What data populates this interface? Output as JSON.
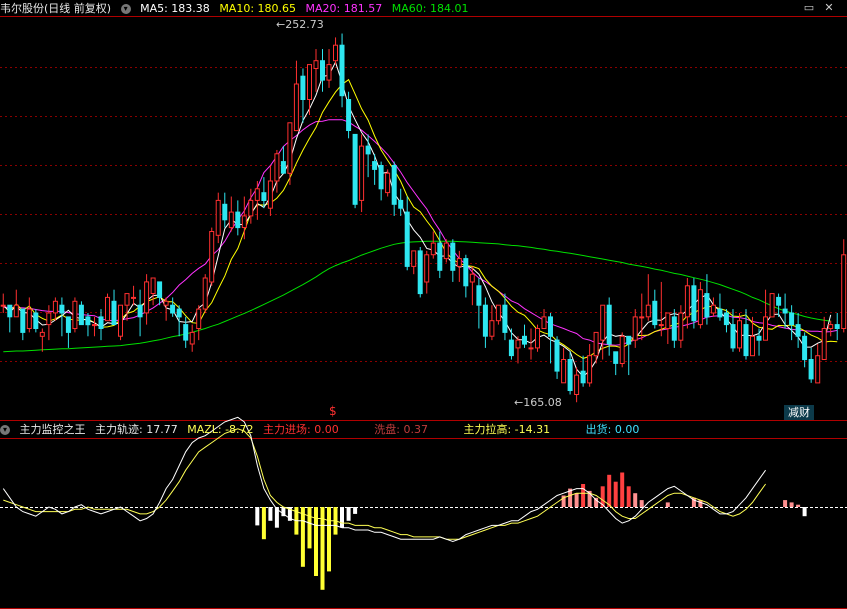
{
  "title": "韦尔股份(日线 前复权)",
  "ma": {
    "ma5": "MA5: 183.38",
    "ma10": "MA10: 180.65",
    "ma20": "MA20: 181.57",
    "ma60": "MA60: 184.01"
  },
  "colors": {
    "up": "#ff3030",
    "down": "#2ee6f0",
    "ma5": "#ffffff",
    "ma10": "#ffff00",
    "ma20": "#ff33ff",
    "ma60": "#00e000",
    "grid": "#8b0000"
  },
  "price_labels": {
    "high": "252.73",
    "low": "165.08"
  },
  "signal_marker": "$",
  "tag": "减财",
  "close_symbol": "✕",
  "indicator": {
    "name": "主力监控之王",
    "guiji": "主力轨迹: 17.77",
    "mazl": "MAZL: -8.72",
    "jinchang": "主力进场: 0.00",
    "xipan": "洗盘: 0.37",
    "lagao": "主力拉高: -14.31",
    "chuhuo": "出货: 0.00"
  },
  "chart_data": {
    "type": "candlestick",
    "candles": [
      [
        183,
        183,
        181,
        186
      ],
      [
        183,
        180,
        176,
        183
      ],
      [
        180,
        183,
        180,
        187
      ],
      [
        182,
        176,
        174,
        182
      ],
      [
        177,
        182,
        176,
        185
      ],
      [
        181,
        177,
        176,
        182
      ],
      [
        175,
        176,
        171,
        177
      ],
      [
        178,
        181,
        174,
        183
      ],
      [
        181,
        184,
        179,
        185
      ],
      [
        183,
        181,
        175,
        185
      ],
      [
        180,
        176,
        172,
        180
      ],
      [
        177,
        184,
        176,
        185
      ],
      [
        183,
        178,
        178,
        184
      ],
      [
        180,
        178,
        175,
        181
      ],
      [
        178,
        178,
        175,
        180
      ],
      [
        180,
        177,
        174,
        182
      ],
      [
        179,
        185,
        179,
        186
      ],
      [
        184,
        178,
        178,
        187
      ],
      [
        175,
        183,
        174,
        183
      ],
      [
        183,
        186,
        179,
        186
      ],
      [
        185,
        185,
        183,
        188
      ],
      [
        183,
        180,
        175,
        187
      ],
      [
        181,
        189,
        178,
        191
      ],
      [
        186,
        190,
        183,
        190
      ],
      [
        189,
        185,
        183,
        189
      ],
      [
        183,
        184,
        179,
        185
      ],
      [
        183,
        181,
        180,
        185
      ],
      [
        182,
        180,
        175,
        183
      ],
      [
        178,
        174,
        172,
        180
      ],
      [
        173,
        176,
        171,
        178
      ],
      [
        177,
        182,
        174,
        183
      ],
      [
        182,
        190,
        181,
        191
      ],
      [
        189,
        202,
        188,
        203
      ],
      [
        201,
        210,
        199,
        212
      ],
      [
        209,
        205,
        203,
        212
      ],
      [
        203,
        207,
        202,
        211
      ],
      [
        207,
        203,
        201,
        210
      ],
      [
        203,
        206,
        200,
        211
      ],
      [
        206,
        210,
        204,
        213
      ],
      [
        210,
        213,
        205,
        215
      ],
      [
        212,
        210,
        208,
        216
      ],
      [
        208,
        215,
        206,
        219
      ],
      [
        215,
        222,
        212,
        223
      ],
      [
        220,
        217,
        217,
        224
      ],
      [
        217,
        230,
        214,
        230
      ],
      [
        228,
        240,
        228,
        246
      ],
      [
        242,
        236,
        230,
        244
      ],
      [
        236,
        245,
        232,
        245
      ],
      [
        244,
        246,
        238,
        249
      ],
      [
        246,
        241,
        238,
        249
      ],
      [
        241,
        245,
        239,
        249
      ],
      [
        246,
        250,
        245,
        252
      ],
      [
        250,
        237,
        234,
        253
      ],
      [
        236,
        228,
        226,
        238
      ],
      [
        227,
        209,
        208,
        227
      ],
      [
        210,
        224,
        207,
        227
      ],
      [
        224,
        222,
        216,
        227
      ],
      [
        220,
        218,
        214,
        222
      ],
      [
        219,
        213,
        210,
        220
      ],
      [
        212,
        217,
        211,
        218
      ],
      [
        219,
        209,
        206,
        220
      ],
      [
        210,
        208,
        206,
        213
      ],
      [
        207,
        193,
        192,
        211
      ],
      [
        193,
        197,
        191,
        197
      ],
      [
        197,
        186,
        185,
        198
      ],
      [
        189,
        196,
        186,
        197
      ],
      [
        196,
        199,
        195,
        202
      ],
      [
        199,
        192,
        190,
        202
      ],
      [
        195,
        199,
        194,
        200
      ],
      [
        199,
        192,
        189,
        200
      ],
      [
        193,
        195,
        189,
        197
      ],
      [
        195,
        188,
        185,
        196
      ],
      [
        189,
        191,
        183,
        193
      ],
      [
        188,
        183,
        177,
        190
      ],
      [
        183,
        175,
        172,
        185
      ],
      [
        175,
        179,
        174,
        183
      ],
      [
        179,
        183,
        178,
        183
      ],
      [
        183,
        176,
        174,
        186
      ],
      [
        174,
        170,
        169,
        177
      ],
      [
        172,
        174,
        168,
        175
      ],
      [
        175,
        173,
        172,
        178
      ],
      [
        172,
        172,
        169,
        177
      ],
      [
        172,
        177,
        171,
        178
      ],
      [
        177,
        180,
        177,
        182
      ],
      [
        180,
        175,
        168,
        181
      ],
      [
        174,
        166,
        164,
        175
      ],
      [
        163,
        169,
        163,
        172
      ],
      [
        169,
        161,
        160,
        171
      ],
      [
        160,
        165,
        158,
        167
      ],
      [
        166,
        163,
        162,
        170
      ],
      [
        163,
        170,
        162,
        173
      ],
      [
        170,
        176,
        168,
        176
      ],
      [
        174,
        183,
        169,
        183
      ],
      [
        183,
        173,
        170,
        185
      ],
      [
        171,
        168,
        165,
        171
      ],
      [
        168,
        175,
        167,
        176
      ],
      [
        175,
        173,
        165,
        175
      ],
      [
        174,
        180,
        172,
        182
      ],
      [
        180,
        180,
        174,
        186
      ],
      [
        180,
        183,
        179,
        191
      ],
      [
        184,
        178,
        177,
        187
      ],
      [
        178,
        178,
        175,
        189
      ],
      [
        177,
        181,
        173,
        181
      ],
      [
        180,
        174,
        172,
        182
      ],
      [
        174,
        181,
        172,
        183
      ],
      [
        180,
        188,
        177,
        190
      ],
      [
        188,
        179,
        177,
        190
      ],
      [
        178,
        187,
        177,
        189
      ],
      [
        186,
        180,
        178,
        191
      ],
      [
        181,
        183,
        180,
        185
      ],
      [
        182,
        180,
        179,
        186
      ],
      [
        181,
        178,
        176,
        182
      ],
      [
        178,
        172,
        171,
        182
      ],
      [
        172,
        179,
        171,
        181
      ],
      [
        178,
        170,
        169,
        182
      ],
      [
        170,
        175,
        170,
        180
      ],
      [
        175,
        174,
        170,
        177
      ],
      [
        174,
        180,
        174,
        187
      ],
      [
        180,
        186,
        180,
        186
      ],
      [
        185,
        183,
        180,
        186
      ],
      [
        182,
        181,
        177,
        186
      ],
      [
        181,
        178,
        174,
        183
      ],
      [
        178,
        175,
        172,
        181
      ],
      [
        175,
        169,
        167,
        176
      ],
      [
        169,
        164,
        163,
        172
      ],
      [
        163,
        170,
        163,
        173
      ],
      [
        169,
        177,
        169,
        180
      ],
      [
        177,
        178,
        175,
        179
      ],
      [
        178,
        177,
        174,
        181
      ],
      [
        177,
        196,
        176,
        200
      ]
    ],
    "ma5": [
      183,
      181.3,
      182.7,
      181.1,
      181,
      179.3,
      177.9,
      178.1,
      179.2,
      180.3,
      181.7,
      180,
      179.5,
      179.1,
      178.5,
      177.3,
      178.5,
      178.2,
      178.4,
      180.8,
      183.5,
      182.3,
      184.1,
      185.5,
      185.6,
      182.3,
      181.8,
      178.8,
      178.6,
      178.8,
      182.3,
      183.6,
      188.9,
      195.8,
      202.7,
      205,
      203.9,
      203.7,
      206.4,
      209.2,
      208.2,
      210.9,
      215,
      216.9,
      220.2,
      225.9,
      230.6,
      233.6,
      237.1,
      241.9,
      242.3,
      245.6,
      240.3,
      234.3,
      230.8,
      227.5,
      225.1,
      221.5,
      216.9,
      217.3,
      211.8,
      209.4,
      205,
      202.4,
      200.5,
      197.6,
      197.2,
      195.6,
      195.7,
      193.8,
      192.8,
      193.2,
      192.5,
      191,
      187.8,
      183.9,
      181.1,
      178.9,
      175.9,
      174.2,
      174,
      173.2,
      174.7,
      175.3,
      174.1,
      173.4,
      172.4,
      171.1,
      166.5,
      164.6,
      166.1,
      168.8,
      173.6,
      175.6,
      175,
      175.3,
      174.6,
      174.5,
      176.6,
      178.6,
      179.2,
      179.1,
      180.4,
      180.8,
      180.4,
      181.7,
      183.3,
      184.9,
      185.7,
      183.1,
      181.4,
      179.4,
      177.4,
      175.2,
      175.3,
      175.1,
      175.7,
      178.4,
      180.6,
      180.7,
      178,
      176.5,
      174.8,
      172.2,
      172.2,
      173.2,
      173.9,
      180.5
    ],
    "ma10": [
      183,
      181.2,
      183.3,
      181.6,
      182.8,
      180.6,
      179.6,
      178.9,
      179.5,
      180.5,
      179.5,
      179.1,
      179.2,
      179.4,
      178.5,
      177.3,
      177.4,
      177.8,
      179.3,
      180.9,
      181.4,
      182.8,
      183.9,
      184.6,
      185.2,
      183.9,
      183.9,
      182.3,
      180.3,
      178.5,
      178.3,
      181.5,
      183.7,
      187.2,
      190.5,
      194.8,
      197.6,
      202.1,
      206.7,
      208.9,
      208.8,
      209.3,
      210.6,
      212.6,
      215.8,
      219.6,
      223,
      226,
      228.8,
      232.7,
      235.4,
      237.9,
      239.9,
      241.1,
      237.4,
      233.6,
      230.7,
      226.6,
      223,
      220.3,
      217.8,
      214.9,
      211.1,
      208.3,
      207.1,
      204.7,
      202.5,
      199.6,
      196.5,
      194.8,
      193.8,
      193.2,
      193,
      192.4,
      189.8,
      187.9,
      186.6,
      184.8,
      182.7,
      181.2,
      180.4,
      178.6,
      176.6,
      175.9,
      175.4,
      173.8,
      172.8,
      171.6,
      170.3,
      169.3,
      169.8,
      171.1,
      171.9,
      172.5,
      172.4,
      172,
      173,
      175.2,
      175.2,
      175.3,
      176.2,
      176.8,
      177.4,
      178,
      178.5,
      180.3,
      181.1,
      181.9,
      182.6,
      182.7,
      182.1,
      181.6,
      180.2,
      180.1,
      180.5,
      178.4,
      177.3,
      177,
      176.8,
      177.8,
      177.7,
      177.9,
      177.3,
      176.4,
      175.3,
      174.6,
      173.5,
      173.7,
      173.6
    ],
    "ma20": [
      182.5,
      182.4,
      182.4,
      182.3,
      182.2,
      181.9,
      181.6,
      181.4,
      181.4,
      181.4,
      181.1,
      180.8,
      180.6,
      180.4,
      180.3,
      179.5,
      179.1,
      179,
      179.2,
      179.5,
      179.8,
      180.5,
      181.4,
      182.3,
      183.5,
      184.7,
      186.3,
      188.2,
      189.6,
      191.2,
      192.5,
      193.6,
      195.8,
      197.3,
      199.5,
      202.4,
      205,
      207.3,
      210.7,
      213.3,
      217.2,
      219,
      221.4,
      223.9,
      225.4,
      226.7,
      228.2,
      229.4,
      230.3,
      230.4,
      230.8,
      230.8,
      230.8,
      230.2,
      229.1,
      228.1,
      226.7,
      225.2,
      223.6,
      221.8,
      219.6,
      217.3,
      214.6,
      212.3,
      210,
      207.8,
      204.8,
      202.3,
      199.4,
      197.2,
      195,
      193.5,
      191.5,
      190,
      189.1,
      187.9,
      186.6,
      185.4,
      184.1,
      183.4,
      182.1,
      181.1,
      180.1,
      179.1,
      178.2,
      177.6,
      177,
      176.3,
      175.7,
      174.4,
      174,
      173.3,
      173,
      172.8,
      172.7,
      172.9,
      173.5,
      174.1,
      174.6,
      175.4,
      176.2,
      176.6,
      176.9,
      177.3,
      177.6,
      178,
      178.5,
      179.2,
      179.9,
      180.2,
      180.3,
      180.4,
      179.9,
      179.8,
      179.5,
      178.8,
      178.5,
      178.3,
      177.8,
      177.5,
      177.1,
      176.8,
      176.6,
      176.4,
      176.3,
      176.3,
      176.1,
      176.2,
      176.5
    ],
    "ma60": [
      171,
      171.1,
      171.2,
      171.2,
      171.3,
      171.4,
      171.5,
      171.6,
      171.7,
      171.8,
      171.8,
      171.9,
      172,
      172.1,
      172.2,
      172.3,
      172.4,
      172.5,
      172.6,
      172.8,
      173,
      173.2,
      173.5,
      173.8,
      174.1,
      174.5,
      174.9,
      175.2,
      175.6,
      176,
      176.5,
      177,
      177.6,
      178.1,
      178.8,
      179.5,
      180.2,
      180.9,
      181.6,
      182.4,
      183.2,
      184,
      184.8,
      185.6,
      186.5,
      187.4,
      188.3,
      189.3,
      190.3,
      191.4,
      192.4,
      193.2,
      193.9,
      194.5,
      195.2,
      195.9,
      196.5,
      197.1,
      197.7,
      198.2,
      198.7,
      199,
      199.2,
      199.3,
      199.4,
      199.5,
      199.5,
      199.5,
      199.5,
      199.5,
      199.4,
      199.3,
      199.2,
      199.1,
      199,
      198.9,
      198.8,
      198.6,
      198.4,
      198.3,
      198.1,
      197.9,
      197.6,
      197.4,
      197.1,
      196.9,
      196.6,
      196.4,
      196.1,
      195.8,
      195.5,
      195.2,
      194.9,
      194.6,
      194.3,
      194,
      193.6,
      193.3,
      193,
      192.7,
      192.3,
      192,
      191.6,
      191.2,
      190.9,
      190.5,
      190.1,
      189.7,
      189.3,
      188.8,
      188.3,
      187.7,
      187.1,
      186.5,
      185.8,
      185,
      184.4,
      183.6,
      182.8,
      182.1,
      181.5,
      181,
      180.6,
      180.1,
      179.7,
      179.4,
      179.1,
      178.9
    ],
    "price_axis": {
      "ymin": 156,
      "ymax": 257
    },
    "indicator_guiji": [
      8,
      4,
      0,
      -2,
      -3,
      -4,
      -2,
      0,
      -1,
      -3,
      -2,
      0,
      1,
      -1,
      -2,
      -3,
      -2,
      -1,
      0,
      -2,
      -4,
      -6,
      -5,
      -3,
      2,
      8,
      12,
      18,
      24,
      28,
      30,
      31,
      33,
      35,
      37,
      38,
      39,
      37,
      31,
      18,
      8,
      3,
      -1,
      -3,
      -5,
      -6,
      -6,
      -7,
      -8,
      -8,
      -8,
      -8,
      -9,
      -9,
      -10,
      -10,
      -10,
      -11,
      -11,
      -12,
      -13,
      -14,
      -14,
      -14,
      -14,
      -14,
      -14,
      -13,
      -14,
      -15,
      -14,
      -12,
      -11,
      -10,
      -9,
      -8,
      -8,
      -7,
      -6,
      -6,
      -4,
      -2,
      -1,
      1,
      3,
      5,
      6,
      7,
      8,
      8,
      6,
      3,
      1,
      -2,
      -5,
      -7,
      -6,
      -4,
      -1,
      2,
      4,
      6,
      8,
      9,
      7,
      5,
      3,
      2,
      1,
      -1,
      -3,
      -3,
      -2,
      1,
      4,
      8,
      12,
      16
    ],
    "indicator_mazl": [
      3,
      2,
      1,
      0,
      -1,
      -2,
      -2,
      -2,
      -2,
      -2,
      -2,
      -1,
      -1,
      0,
      -1,
      -1,
      -1,
      -1,
      -1,
      -1,
      -2,
      -3,
      -3,
      -2,
      0,
      3,
      7,
      11,
      16,
      20,
      24,
      26,
      28,
      30,
      32,
      33,
      34,
      33,
      30,
      22,
      12,
      5,
      2,
      0,
      -1,
      -2,
      -3,
      -4,
      -5,
      -5,
      -6,
      -6,
      -7,
      -7,
      -8,
      -8,
      -8,
      -9,
      -9,
      -10,
      -11,
      -12,
      -12,
      -13,
      -13,
      -13,
      -13,
      -13,
      -14,
      -14,
      -14,
      -13,
      -12,
      -11,
      -10,
      -9,
      -8,
      -8,
      -7,
      -7,
      -6,
      -5,
      -4,
      -2,
      0,
      2,
      4,
      5,
      6,
      6,
      6,
      5,
      3,
      1,
      -2,
      -4,
      -5,
      -5,
      -3,
      -1,
      1,
      3,
      5,
      6,
      6,
      5,
      4,
      3,
      2,
      0,
      -2,
      -3,
      -4,
      -3,
      -1,
      2,
      6,
      10
    ],
    "indicator_bars": [
      0,
      0,
      0,
      0,
      0,
      0,
      0,
      0,
      0,
      0,
      0,
      0,
      0,
      0,
      0,
      0,
      0,
      0,
      0,
      0,
      0,
      0,
      0,
      0,
      0,
      0,
      0,
      0,
      0,
      0,
      0,
      0,
      0,
      0,
      0,
      0,
      0,
      0,
      0,
      -8,
      -14,
      -6,
      -9,
      -4,
      -6,
      -12,
      -26,
      -18,
      -30,
      -36,
      -28,
      -12,
      -9,
      -6,
      -3,
      0,
      0,
      0,
      0,
      0,
      0,
      0,
      0,
      0,
      0,
      0,
      0,
      0,
      0,
      0,
      0,
      0,
      0,
      0,
      0,
      0,
      0,
      0,
      0,
      0,
      0,
      0,
      0,
      0,
      0,
      0,
      5,
      8,
      6,
      10,
      7,
      4,
      9,
      14,
      11,
      15,
      9,
      6,
      3,
      0,
      0,
      0,
      2,
      0,
      0,
      0,
      4,
      3,
      0,
      0,
      0,
      0,
      0,
      0,
      0,
      0,
      0,
      0,
      0,
      0,
      3,
      2,
      1,
      -4
    ],
    "indicator_bar_colors": [
      "#ffffff",
      "#ffff33",
      "#ff4040",
      "#ff9090"
    ]
  }
}
